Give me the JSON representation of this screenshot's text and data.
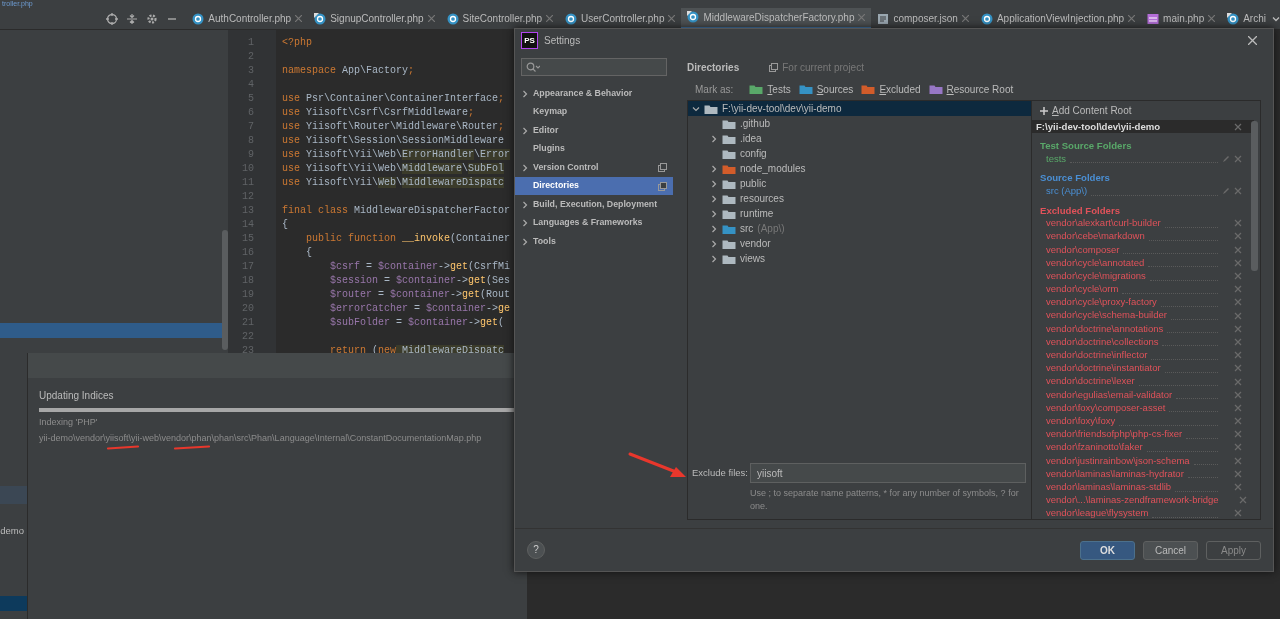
{
  "ide": {
    "breadcrumb": "troller.php",
    "tabs": [
      {
        "label": "AuthController.php",
        "kind": "class",
        "selected": false,
        "closable": true
      },
      {
        "label": "SignupController.php",
        "kind": "special",
        "selected": false,
        "closable": true
      },
      {
        "label": "SiteController.php",
        "kind": "class",
        "selected": false,
        "closable": true
      },
      {
        "label": "UserController.php",
        "kind": "class",
        "selected": false,
        "closable": true
      },
      {
        "label": "MiddlewareDispatcherFactory.php",
        "kind": "special",
        "selected": true,
        "closable": true
      },
      {
        "label": "composer.json",
        "kind": "json",
        "selected": false,
        "closable": true
      },
      {
        "label": "ApplicationViewInjection.php",
        "kind": "class",
        "selected": false,
        "closable": true
      },
      {
        "label": "main.php",
        "kind": "php",
        "selected": false,
        "closable": true
      },
      {
        "label": "Archi",
        "kind": "special",
        "selected": false,
        "closable": false
      }
    ],
    "project_tree": {
      "fragment": "demo"
    },
    "code": [
      {
        "n": "1",
        "tokens": [
          {
            "text": "<?php",
            "kind": "keyword"
          }
        ]
      },
      {
        "n": "2"
      },
      {
        "n": "3",
        "tokens": [
          {
            "text": "namespace",
            "kind": "keyword"
          },
          {
            "text": " App\\Factory",
            "kind": "plain"
          },
          {
            "text": ";",
            "kind": "keyword"
          }
        ]
      },
      {
        "n": "4"
      },
      {
        "n": "5",
        "tokens": [
          {
            "text": "use",
            "kind": "keyword"
          },
          {
            "text": " Psr\\Container\\ContainerInterface",
            "kind": "plain"
          },
          {
            "text": ";",
            "kind": "keyword"
          }
        ]
      },
      {
        "n": "6",
        "tokens": [
          {
            "text": "use",
            "kind": "keyword"
          },
          {
            "text": " Yiisoft\\Csrf\\CsrfMiddleware",
            "kind": "plain"
          },
          {
            "text": ";",
            "kind": "keyword"
          }
        ]
      },
      {
        "n": "7",
        "tokens": [
          {
            "text": "use",
            "kind": "keyword"
          },
          {
            "text": " Yiisoft\\Router\\Middleware\\Router",
            "kind": "plain"
          },
          {
            "text": ";",
            "kind": "keyword"
          }
        ]
      },
      {
        "n": "8",
        "tokens": [
          {
            "text": "use",
            "kind": "keyword"
          },
          {
            "text": " Yiisoft\\Session\\SessionMiddleware",
            "kind": "plain"
          }
        ]
      },
      {
        "n": "9",
        "tokens": [
          {
            "text": "use",
            "kind": "keyword"
          },
          {
            "text": " Yiisoft\\Yii\\Web\\",
            "kind": "plain"
          },
          {
            "text": "ErrorHandler",
            "kind": "highlight"
          },
          {
            "text": "\\",
            "kind": "plain"
          },
          {
            "text": "Error",
            "kind": "highlight"
          }
        ]
      },
      {
        "n": "10",
        "tokens": [
          {
            "text": "use",
            "kind": "keyword"
          },
          {
            "text": " Yiisoft\\Yii\\Web\\",
            "kind": "plain"
          },
          {
            "text": "Middleware",
            "kind": "highlight"
          },
          {
            "text": "\\",
            "kind": "plain"
          },
          {
            "text": "SubFol",
            "kind": "highlight"
          }
        ]
      },
      {
        "n": "11",
        "tokens": [
          {
            "text": "use",
            "kind": "keyword"
          },
          {
            "text": " Yiisoft\\Yii\\",
            "kind": "plain"
          },
          {
            "text": "Web",
            "kind": "highlight"
          },
          {
            "text": "\\",
            "kind": "plain"
          },
          {
            "text": "MiddlewareDispatc",
            "kind": "highlight"
          }
        ]
      },
      {
        "n": "12"
      },
      {
        "n": "13",
        "tokens": [
          {
            "text": "final class",
            "kind": "keyword"
          },
          {
            "text": " MiddlewareDispatcherFactor",
            "kind": "plain"
          }
        ]
      },
      {
        "n": "14",
        "tokens": [
          {
            "text": "{",
            "kind": "plain"
          }
        ]
      },
      {
        "n": "15",
        "tokens": [
          {
            "text": "    public function",
            "kind": "keyword"
          },
          {
            "text": " __invoke",
            "kind": "function"
          },
          {
            "text": "(Container",
            "kind": "plain"
          }
        ]
      },
      {
        "n": "16",
        "tokens": [
          {
            "text": "    {",
            "kind": "plain"
          }
        ]
      },
      {
        "n": "17",
        "tokens": [
          {
            "text": "        $csrf",
            "kind": "variable"
          },
          {
            "text": " = ",
            "kind": "plain"
          },
          {
            "text": "$container",
            "kind": "variable"
          },
          {
            "text": "->",
            "kind": "plain"
          },
          {
            "text": "get",
            "kind": "function"
          },
          {
            "text": "(CsrfMi",
            "kind": "plain"
          }
        ]
      },
      {
        "n": "18",
        "tokens": [
          {
            "text": "        $session",
            "kind": "variable"
          },
          {
            "text": " = ",
            "kind": "plain"
          },
          {
            "text": "$container",
            "kind": "variable"
          },
          {
            "text": "->",
            "kind": "plain"
          },
          {
            "text": "get",
            "kind": "function"
          },
          {
            "text": "(Ses",
            "kind": "plain"
          }
        ]
      },
      {
        "n": "19",
        "tokens": [
          {
            "text": "        $router",
            "kind": "variable"
          },
          {
            "text": " = ",
            "kind": "plain"
          },
          {
            "text": "$container",
            "kind": "variable"
          },
          {
            "text": "->",
            "kind": "plain"
          },
          {
            "text": "get",
            "kind": "function"
          },
          {
            "text": "(Rout",
            "kind": "plain"
          }
        ]
      },
      {
        "n": "20",
        "tokens": [
          {
            "text": "        $errorCatcher",
            "kind": "variable"
          },
          {
            "text": " = ",
            "kind": "plain"
          },
          {
            "text": "$container",
            "kind": "variable"
          },
          {
            "text": "->",
            "kind": "plain"
          },
          {
            "text": "ge",
            "kind": "function"
          }
        ]
      },
      {
        "n": "21",
        "tokens": [
          {
            "text": "        $subFolder",
            "kind": "variable"
          },
          {
            "text": " = ",
            "kind": "plain"
          },
          {
            "text": "$container",
            "kind": "variable"
          },
          {
            "text": "->",
            "kind": "plain"
          },
          {
            "text": "get",
            "kind": "function"
          },
          {
            "text": "(",
            "kind": "plain"
          }
        ]
      },
      {
        "n": "22"
      },
      {
        "n": "23",
        "tokens": [
          {
            "text": "        return",
            "kind": "keyword"
          },
          {
            "text": " (",
            "kind": "plain"
          },
          {
            "text": "new",
            "kind": "keyword"
          },
          {
            "text": " MiddlewareDispatc",
            "kind": "highlight"
          }
        ]
      }
    ]
  },
  "progress_dialog": {
    "title": "Updating Indices",
    "level": 1,
    "status": "Indexing 'PHP'",
    "path": "yii-demo\\vendor\\yiisoft\\yii-web\\vendor\\phan\\phan\\src\\Phan\\Language\\Internal\\ConstantDocumentationMap.php"
  },
  "settings": {
    "logo_text": "PS",
    "title": "Settings",
    "nav": [
      {
        "label": "Appearance & Behavior",
        "arrow": true,
        "project_scope": false,
        "selected": false
      },
      {
        "label": "Keymap",
        "arrow": false,
        "project_scope": false,
        "selected": false
      },
      {
        "label": "Editor",
        "arrow": true,
        "project_scope": false,
        "selected": false
      },
      {
        "label": "Plugins",
        "arrow": false,
        "project_scope": false,
        "selected": false
      },
      {
        "label": "Version Control",
        "arrow": true,
        "project_scope": true,
        "selected": false
      },
      {
        "label": "Directories",
        "arrow": false,
        "project_scope": true,
        "selected": true
      },
      {
        "label": "Build, Execution, Deployment",
        "arrow": true,
        "project_scope": false,
        "selected": false
      },
      {
        "label": "Languages & Frameworks",
        "arrow": true,
        "project_scope": false,
        "selected": false
      },
      {
        "label": "Tools",
        "arrow": true,
        "project_scope": false,
        "selected": false
      }
    ],
    "page_title": "Directories",
    "scope_note": "For current project",
    "mark_as_label": "Mark as:",
    "mark_as": [
      {
        "label": "Tests",
        "color": "#59a869"
      },
      {
        "label": "Sources",
        "color": "#3592c4"
      },
      {
        "label": "Excluded",
        "color": "#d25c2a"
      },
      {
        "label": "Resource Root",
        "color": "#9777c5"
      }
    ],
    "tree": [
      {
        "label": "F:\\yii-dev-tool\\dev\\yii-demo",
        "kind": "plain",
        "expanded": true,
        "selected": true,
        "children": [
          {
            "label": ".github",
            "kind": "plain",
            "selected": false
          },
          {
            "label": ".idea",
            "kind": "plain",
            "expanded": false,
            "selected": false
          },
          {
            "label": "config",
            "kind": "plain",
            "selected": false
          },
          {
            "label": "node_modules",
            "kind": "excluded",
            "expanded": false,
            "selected": false
          },
          {
            "label": "public",
            "kind": "plain",
            "expanded": false,
            "selected": false
          },
          {
            "label": "resources",
            "kind": "plain",
            "expanded": false,
            "selected": false
          },
          {
            "label": "runtime",
            "kind": "plain",
            "expanded": false,
            "selected": false
          },
          {
            "label": "src",
            "suffix": "(App\\)",
            "kind": "source",
            "expanded": false,
            "selected": false
          },
          {
            "label": "vendor",
            "kind": "plain",
            "expanded": false,
            "selected": false
          },
          {
            "label": "views",
            "kind": "plain",
            "expanded": false,
            "selected": false
          }
        ]
      }
    ],
    "exclude_label": "Exclude files:",
    "exclude_value": "yiisoft",
    "exclude_hint": "Use ; to separate name patterns, * for any number of symbols, ? for one.",
    "add_root": "Add Content Root",
    "content_root": "F:\\yii-dev-tool\\dev\\yii-demo",
    "sections": [
      {
        "title": "Test Source Folders",
        "kind": "test",
        "folders": [
          {
            "name": "tests",
            "editable": true
          }
        ]
      },
      {
        "title": "Source Folders",
        "kind": "source",
        "folders": [
          {
            "name": "src (App\\)",
            "editable": true
          }
        ]
      },
      {
        "title": "Excluded Folders",
        "kind": "excluded",
        "folders": [
          {
            "name": "vendor\\alexkart\\curl-builder",
            "editable": false
          },
          {
            "name": "vendor\\cebe\\markdown",
            "editable": false
          },
          {
            "name": "vendor\\composer",
            "editable": false
          },
          {
            "name": "vendor\\cycle\\annotated",
            "editable": false
          },
          {
            "name": "vendor\\cycle\\migrations",
            "editable": false
          },
          {
            "name": "vendor\\cycle\\orm",
            "editable": false
          },
          {
            "name": "vendor\\cycle\\proxy-factory",
            "editable": false
          },
          {
            "name": "vendor\\cycle\\schema-builder",
            "editable": false
          },
          {
            "name": "vendor\\doctrine\\annotations",
            "editable": false
          },
          {
            "name": "vendor\\doctrine\\collections",
            "editable": false
          },
          {
            "name": "vendor\\doctrine\\inflector",
            "editable": false
          },
          {
            "name": "vendor\\doctrine\\instantiator",
            "editable": false
          },
          {
            "name": "vendor\\doctrine\\lexer",
            "editable": false
          },
          {
            "name": "vendor\\egulias\\email-validator",
            "editable": false
          },
          {
            "name": "vendor\\foxy\\composer-asset",
            "editable": false
          },
          {
            "name": "vendor\\foxy\\foxy",
            "editable": false
          },
          {
            "name": "vendor\\friendsofphp\\php-cs-fixer",
            "editable": false
          },
          {
            "name": "vendor\\fzaninotto\\faker",
            "editable": false
          },
          {
            "name": "vendor\\justinrainbow\\json-schema",
            "editable": false
          },
          {
            "name": "vendor\\laminas\\laminas-hydrator",
            "editable": false
          },
          {
            "name": "vendor\\laminas\\laminas-stdlib",
            "editable": false
          },
          {
            "name": "vendor\\...\\laminas-zendframework-bridge",
            "editable": false
          },
          {
            "name": "vendor\\league\\flysystem",
            "editable": false
          }
        ]
      }
    ],
    "help": "?",
    "buttons": [
      {
        "label": "OK",
        "kind": "primary",
        "disabled": false
      },
      {
        "label": "Cancel",
        "kind": "normal",
        "disabled": false
      },
      {
        "label": "Apply",
        "kind": "normal",
        "disabled": true
      }
    ]
  }
}
